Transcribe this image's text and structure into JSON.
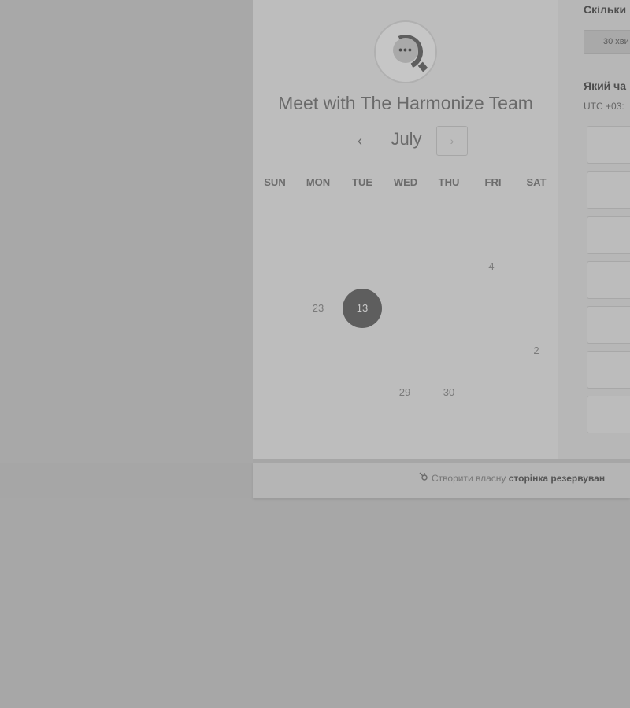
{
  "booking": {
    "title": "Meet with The Harmonize Team",
    "month": "July",
    "prev_icon": "‹",
    "next_icon": "›",
    "weekdays": [
      "SUN",
      "MON",
      "TUE",
      "WED",
      "THU",
      "FRI",
      "SAT"
    ],
    "days": [
      {
        "label": "4"
      },
      {
        "label": "23"
      },
      {
        "label": "13",
        "selected": true
      },
      {
        "label": "2"
      },
      {
        "label": "29"
      },
      {
        "label": "30"
      }
    ]
  },
  "side": {
    "duration_question": "Скільки",
    "duration_value": "30 хви",
    "time_question": "Який ча",
    "timezone": "UTC +03:"
  },
  "footer": {
    "prefix": "Створити власну",
    "bold": "сторінка резервуван"
  },
  "colors": {
    "selected_day": "#5e5e5e",
    "overlay": "#a6a6a6"
  }
}
